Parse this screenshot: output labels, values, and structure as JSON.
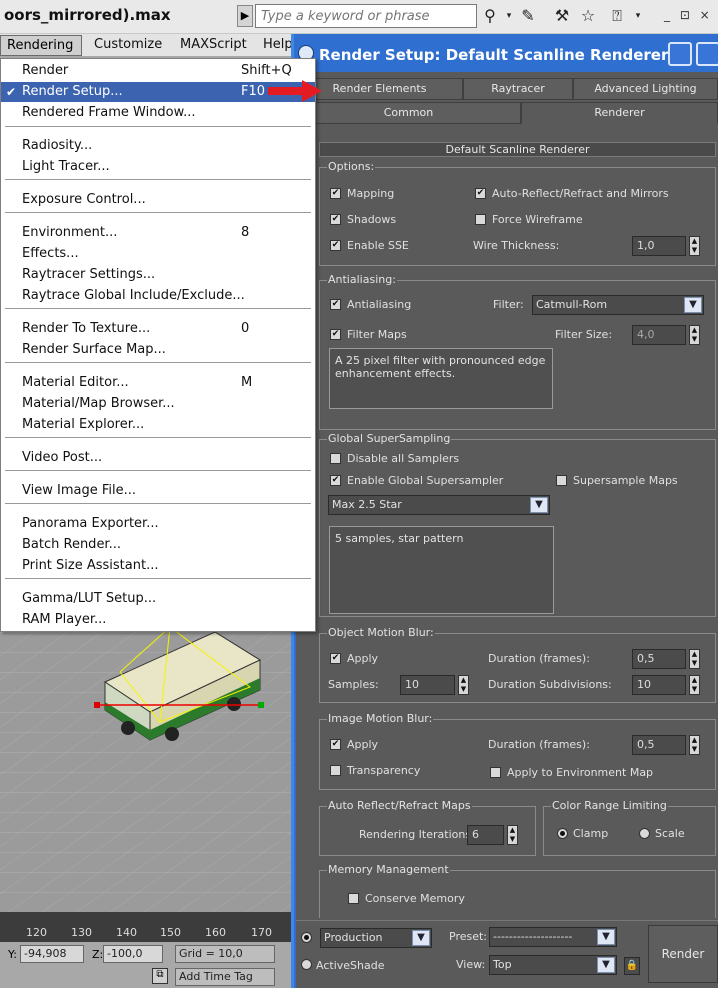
{
  "app": {
    "title": "oors_mirrored).max",
    "search_placeholder": "Type a keyword or phrase",
    "window_controls": "_ ⊡ ×"
  },
  "menubar": {
    "items": [
      "Rendering",
      "Customize",
      "MAXScript",
      "Help"
    ]
  },
  "rendering_menu": {
    "items": [
      {
        "label": "Render",
        "shortcut": "Shift+Q"
      },
      {
        "label": "Render Setup...",
        "shortcut": "F10",
        "checked": true,
        "selected": true
      },
      {
        "label": "Rendered Frame Window...",
        "shortcut": ""
      },
      {
        "label": "Radiosity...",
        "shortcut": ""
      },
      {
        "label": "Light Tracer...",
        "shortcut": ""
      },
      {
        "label": "Exposure Control...",
        "shortcut": ""
      },
      {
        "label": "Environment...",
        "shortcut": "8"
      },
      {
        "label": "Effects...",
        "shortcut": ""
      },
      {
        "label": "Raytracer Settings...",
        "shortcut": ""
      },
      {
        "label": "Raytrace Global Include/Exclude...",
        "shortcut": ""
      },
      {
        "label": "Render To Texture...",
        "shortcut": "0"
      },
      {
        "label": "Render Surface Map...",
        "shortcut": ""
      },
      {
        "label": "Material Editor...",
        "shortcut": "M"
      },
      {
        "label": "Material/Map Browser...",
        "shortcut": ""
      },
      {
        "label": "Material Explorer...",
        "shortcut": ""
      },
      {
        "label": "Video Post...",
        "shortcut": ""
      },
      {
        "label": "View Image File...",
        "shortcut": ""
      },
      {
        "label": "Panorama Exporter...",
        "shortcut": ""
      },
      {
        "label": "Batch Render...",
        "shortcut": ""
      },
      {
        "label": "Print Size Assistant...",
        "shortcut": ""
      },
      {
        "label": "Gamma/LUT Setup...",
        "shortcut": ""
      },
      {
        "label": "RAM Player...",
        "shortcut": ""
      }
    ]
  },
  "status": {
    "ruler_ticks": [
      "120",
      "130",
      "140",
      "150",
      "160",
      "170"
    ],
    "y_label": "Y:",
    "y_value": "-94,908",
    "z_label": "Z:",
    "z_value": "-100,0",
    "grid": "Grid = 10,0",
    "add_time_tag": "Add Time Tag"
  },
  "dialog": {
    "title": "Render Setup: Default Scanline Renderer",
    "tabs_row1": [
      "Render Elements",
      "Raytracer",
      "Advanced Lighting"
    ],
    "tabs_row2": [
      "Common",
      "Renderer"
    ],
    "rollout_title": "Default Scanline Renderer",
    "options": {
      "title": "Options:",
      "mapping": "Mapping",
      "auto_reflect": "Auto-Reflect/Refract and Mirrors",
      "shadows": "Shadows",
      "force_wireframe": "Force Wireframe",
      "enable_sse": "Enable SSE",
      "wire_thickness": "Wire Thickness:",
      "wire_thickness_value": "1,0"
    },
    "antialiasing": {
      "title": "Antialiasing:",
      "antialiasing": "Antialiasing",
      "filter_label": "Filter:",
      "filter_value": "Catmull-Rom",
      "filter_maps": "Filter Maps",
      "filter_size_label": "Filter Size:",
      "filter_size_value": "4,0",
      "description": "A 25 pixel filter with pronounced edge enhancement effects."
    },
    "supersampling": {
      "title": "Global SuperSampling",
      "disable_all": "Disable all Samplers",
      "enable_global": "Enable Global Supersampler",
      "supersample_maps": "Supersample Maps",
      "sampler_value": "Max 2.5 Star",
      "description": "5 samples, star pattern"
    },
    "object_motion_blur": {
      "title": "Object Motion Blur:",
      "apply": "Apply",
      "duration_label": "Duration (frames):",
      "duration_value": "0,5",
      "samples_label": "Samples:",
      "samples_value": "10",
      "subdivisions_label": "Duration Subdivisions:",
      "subdivisions_value": "10"
    },
    "image_motion_blur": {
      "title": "Image Motion Blur:",
      "apply": "Apply",
      "duration_label": "Duration (frames):",
      "duration_value": "0,5",
      "transparency": "Transparency",
      "apply_env": "Apply to Environment Map"
    },
    "auto_reflect_maps": {
      "title": "Auto Reflect/Refract Maps",
      "iterations_label": "Rendering Iterations:",
      "iterations_value": "6"
    },
    "color_range": {
      "title": "Color Range Limiting",
      "clamp": "Clamp",
      "scale": "Scale"
    },
    "memory": {
      "title": "Memory Management",
      "conserve": "Conserve Memory"
    },
    "footer": {
      "production": "Production",
      "activeshade": "ActiveShade",
      "preset_label": "Preset:",
      "preset_value": "--------------------",
      "view_label": "View:",
      "view_value": "Top",
      "render": "Render"
    }
  }
}
